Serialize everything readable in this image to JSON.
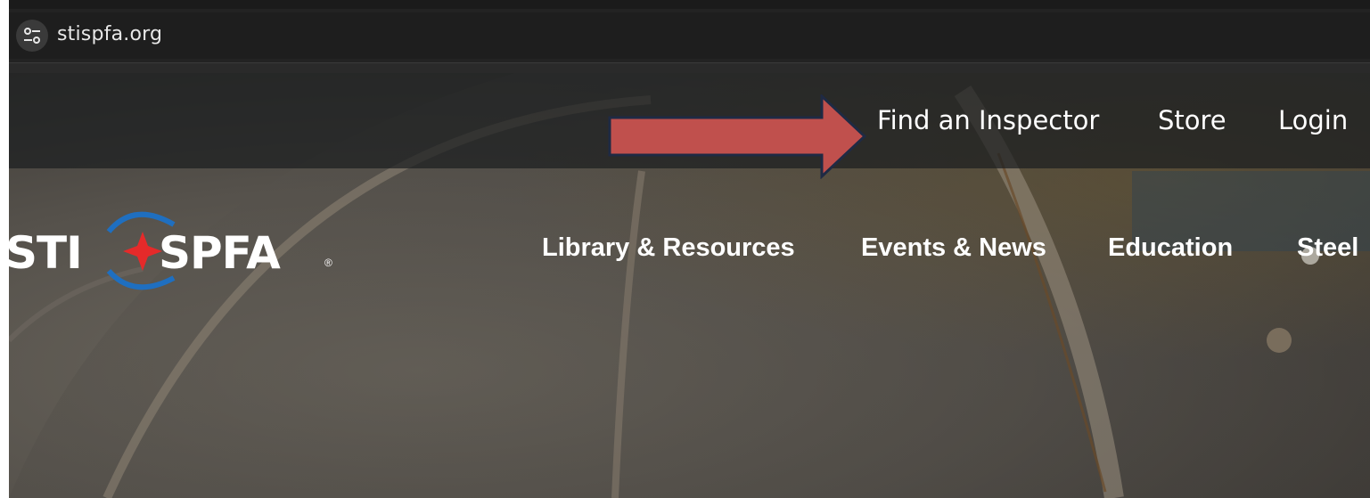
{
  "browser": {
    "url": "stispfa.org",
    "site_info_icon": "tune-icon"
  },
  "utility_nav": {
    "find_inspector": "Find an Inspector",
    "store": "Store",
    "login": "Login"
  },
  "logo": {
    "left": "STI",
    "right": "SPFA",
    "registered": "®"
  },
  "main_nav": {
    "library": "Library & Resources",
    "events": "Events & News",
    "education": "Education",
    "steel": "Steel"
  },
  "annotation": {
    "arrow_color": "#c0504d",
    "arrow_outline": "#1f2a44"
  },
  "colors": {
    "logo_blue": "#1f6fc0",
    "logo_red": "#e52a2a"
  }
}
